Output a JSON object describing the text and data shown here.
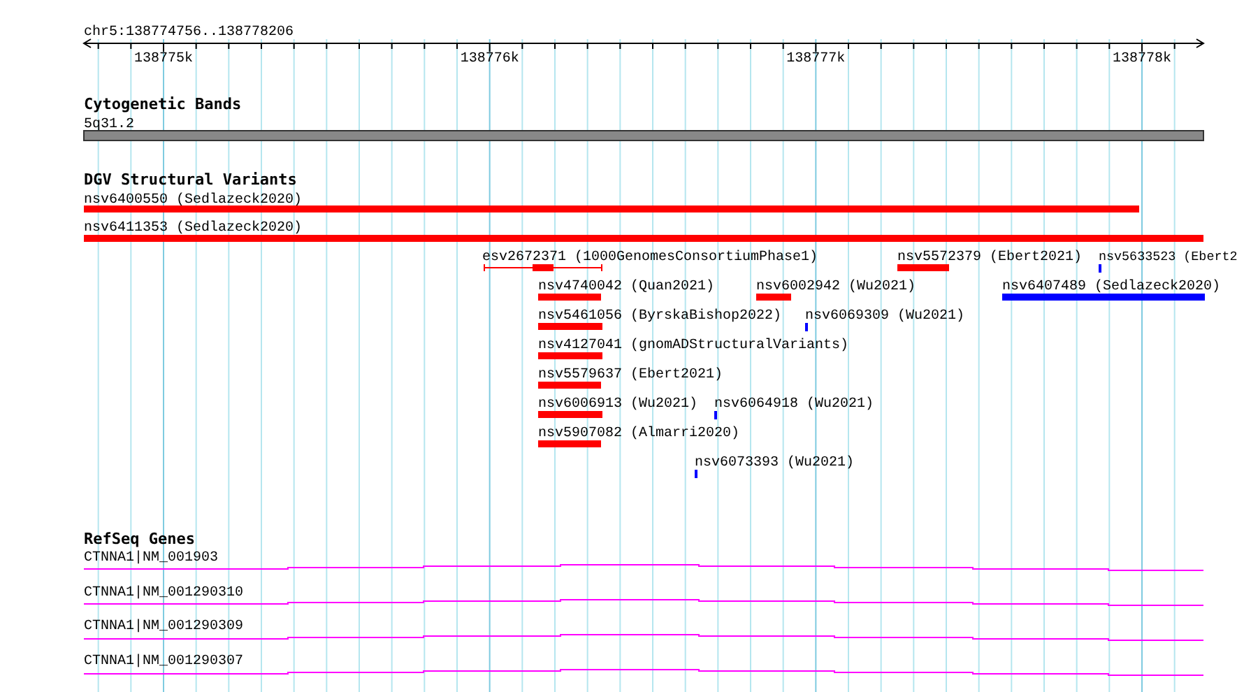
{
  "location": "chr5:138774756..138778206",
  "ruler": {
    "ticks": [
      "138775k",
      "138776k",
      "138777k",
      "138778k"
    ]
  },
  "tracks": [
    {
      "kind": "cytoband",
      "title": "Cytogenetic Bands",
      "features": [
        {
          "label": "5q31.2"
        }
      ]
    },
    {
      "kind": "variants",
      "title": "DGV Structural Variants",
      "features": [
        {
          "label": "nsv6400550 (Sedlazeck2020)",
          "color": "#ff0000",
          "kind": "bar"
        },
        {
          "label": "nsv6411353 (Sedlazeck2020)",
          "color": "#ff0000",
          "kind": "bar"
        },
        {
          "label": "esv2672371 (1000GenomesConsortiumPhase1)",
          "color": "#ff0000",
          "kind": "span"
        },
        {
          "label": "nsv5572379 (Ebert2021)",
          "color": "#ff0000",
          "kind": "bar"
        },
        {
          "label": "nsv5633523 (Ebert2",
          "color": "#0000ff",
          "kind": "bar"
        },
        {
          "label": "nsv4740042 (Quan2021)",
          "color": "#ff0000",
          "kind": "bar"
        },
        {
          "label": "nsv6002942 (Wu2021)",
          "color": "#ff0000",
          "kind": "bar"
        },
        {
          "label": "nsv6407489 (Sedlazeck2020)",
          "color": "#0000ff",
          "kind": "bar"
        },
        {
          "label": "nsv5461056 (ByrskaBishop2022)",
          "color": "#ff0000",
          "kind": "bar"
        },
        {
          "label": "nsv6069309 (Wu2021)",
          "color": "#0000ff",
          "kind": "bar"
        },
        {
          "label": "nsv4127041 (gnomADStructuralVariants)",
          "color": "#ff0000",
          "kind": "bar"
        },
        {
          "label": "nsv5579637 (Ebert2021)",
          "color": "#ff0000",
          "kind": "bar"
        },
        {
          "label": "nsv6006913 (Wu2021)",
          "color": "#ff0000",
          "kind": "bar"
        },
        {
          "label": "nsv6064918 (Wu2021)",
          "color": "#0000ff",
          "kind": "bar"
        },
        {
          "label": "nsv5907082 (Almarri2020)",
          "color": "#ff0000",
          "kind": "bar"
        },
        {
          "label": "nsv6073393 (Wu2021)",
          "color": "#0000ff",
          "kind": "bar"
        }
      ]
    },
    {
      "kind": "genes",
      "title": "RefSeq Genes",
      "features": [
        {
          "label": "CTNNA1|NM_001903"
        },
        {
          "label": "CTNNA1|NM_001290310"
        },
        {
          "label": "CTNNA1|NM_001290309"
        },
        {
          "label": "CTNNA1|NM_001290307"
        }
      ]
    }
  ]
}
